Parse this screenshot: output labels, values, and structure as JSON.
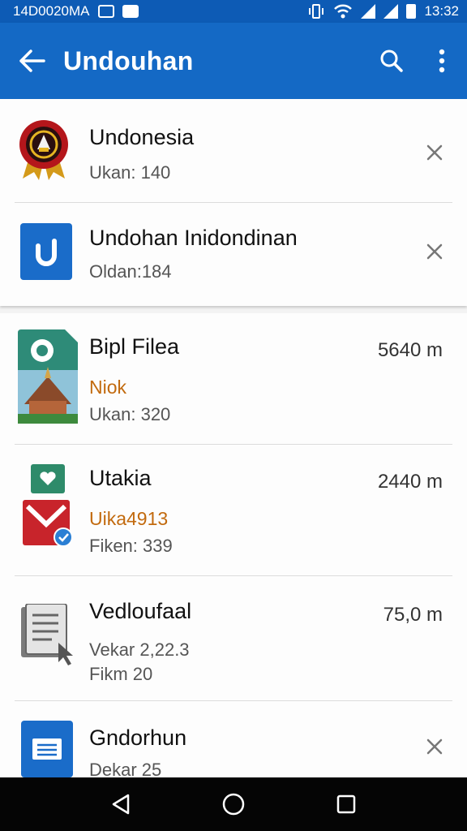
{
  "status_bar": {
    "left_text": "14D0020MA",
    "time": "13:32"
  },
  "app_bar": {
    "title": "Undouhan",
    "icons": [
      "back-arrow-icon",
      "search-icon",
      "overflow-menu-icon"
    ]
  },
  "active_downloads": [
    {
      "title": "Undonesia",
      "subtitle": "Ukan: 140",
      "icon": "emblem-badge-icon"
    },
    {
      "title": "Undohan Inidondinan",
      "subtitle": "Oldan:184",
      "icon": "blue-app-u-icon"
    }
  ],
  "files": [
    {
      "title": "Bipl Filea",
      "orange_text": "Niok",
      "subtitle": "Ukan: 320",
      "size": "5640 m",
      "icon": "temple-app-icon"
    },
    {
      "title": "Utakia",
      "orange_text": "Uika4913",
      "subtitle": "Fiken: 339",
      "size": "2440 m",
      "icon": "gmail-style-icon"
    },
    {
      "title": "Vedloufaal",
      "subtitle": "Vekar 2,22.3",
      "subtitle2": "Fikm 20",
      "size": "75,0 m",
      "icon": "document-cursor-icon"
    },
    {
      "title": "Gndorhun",
      "subtitle": "Dekar 25",
      "icon": "blue-notes-icon"
    }
  ],
  "colors": {
    "status_bar": "#0d5bb5",
    "app_bar": "#1469c5",
    "accent_orange": "#c26a0e",
    "nav_bar": "#050505"
  }
}
